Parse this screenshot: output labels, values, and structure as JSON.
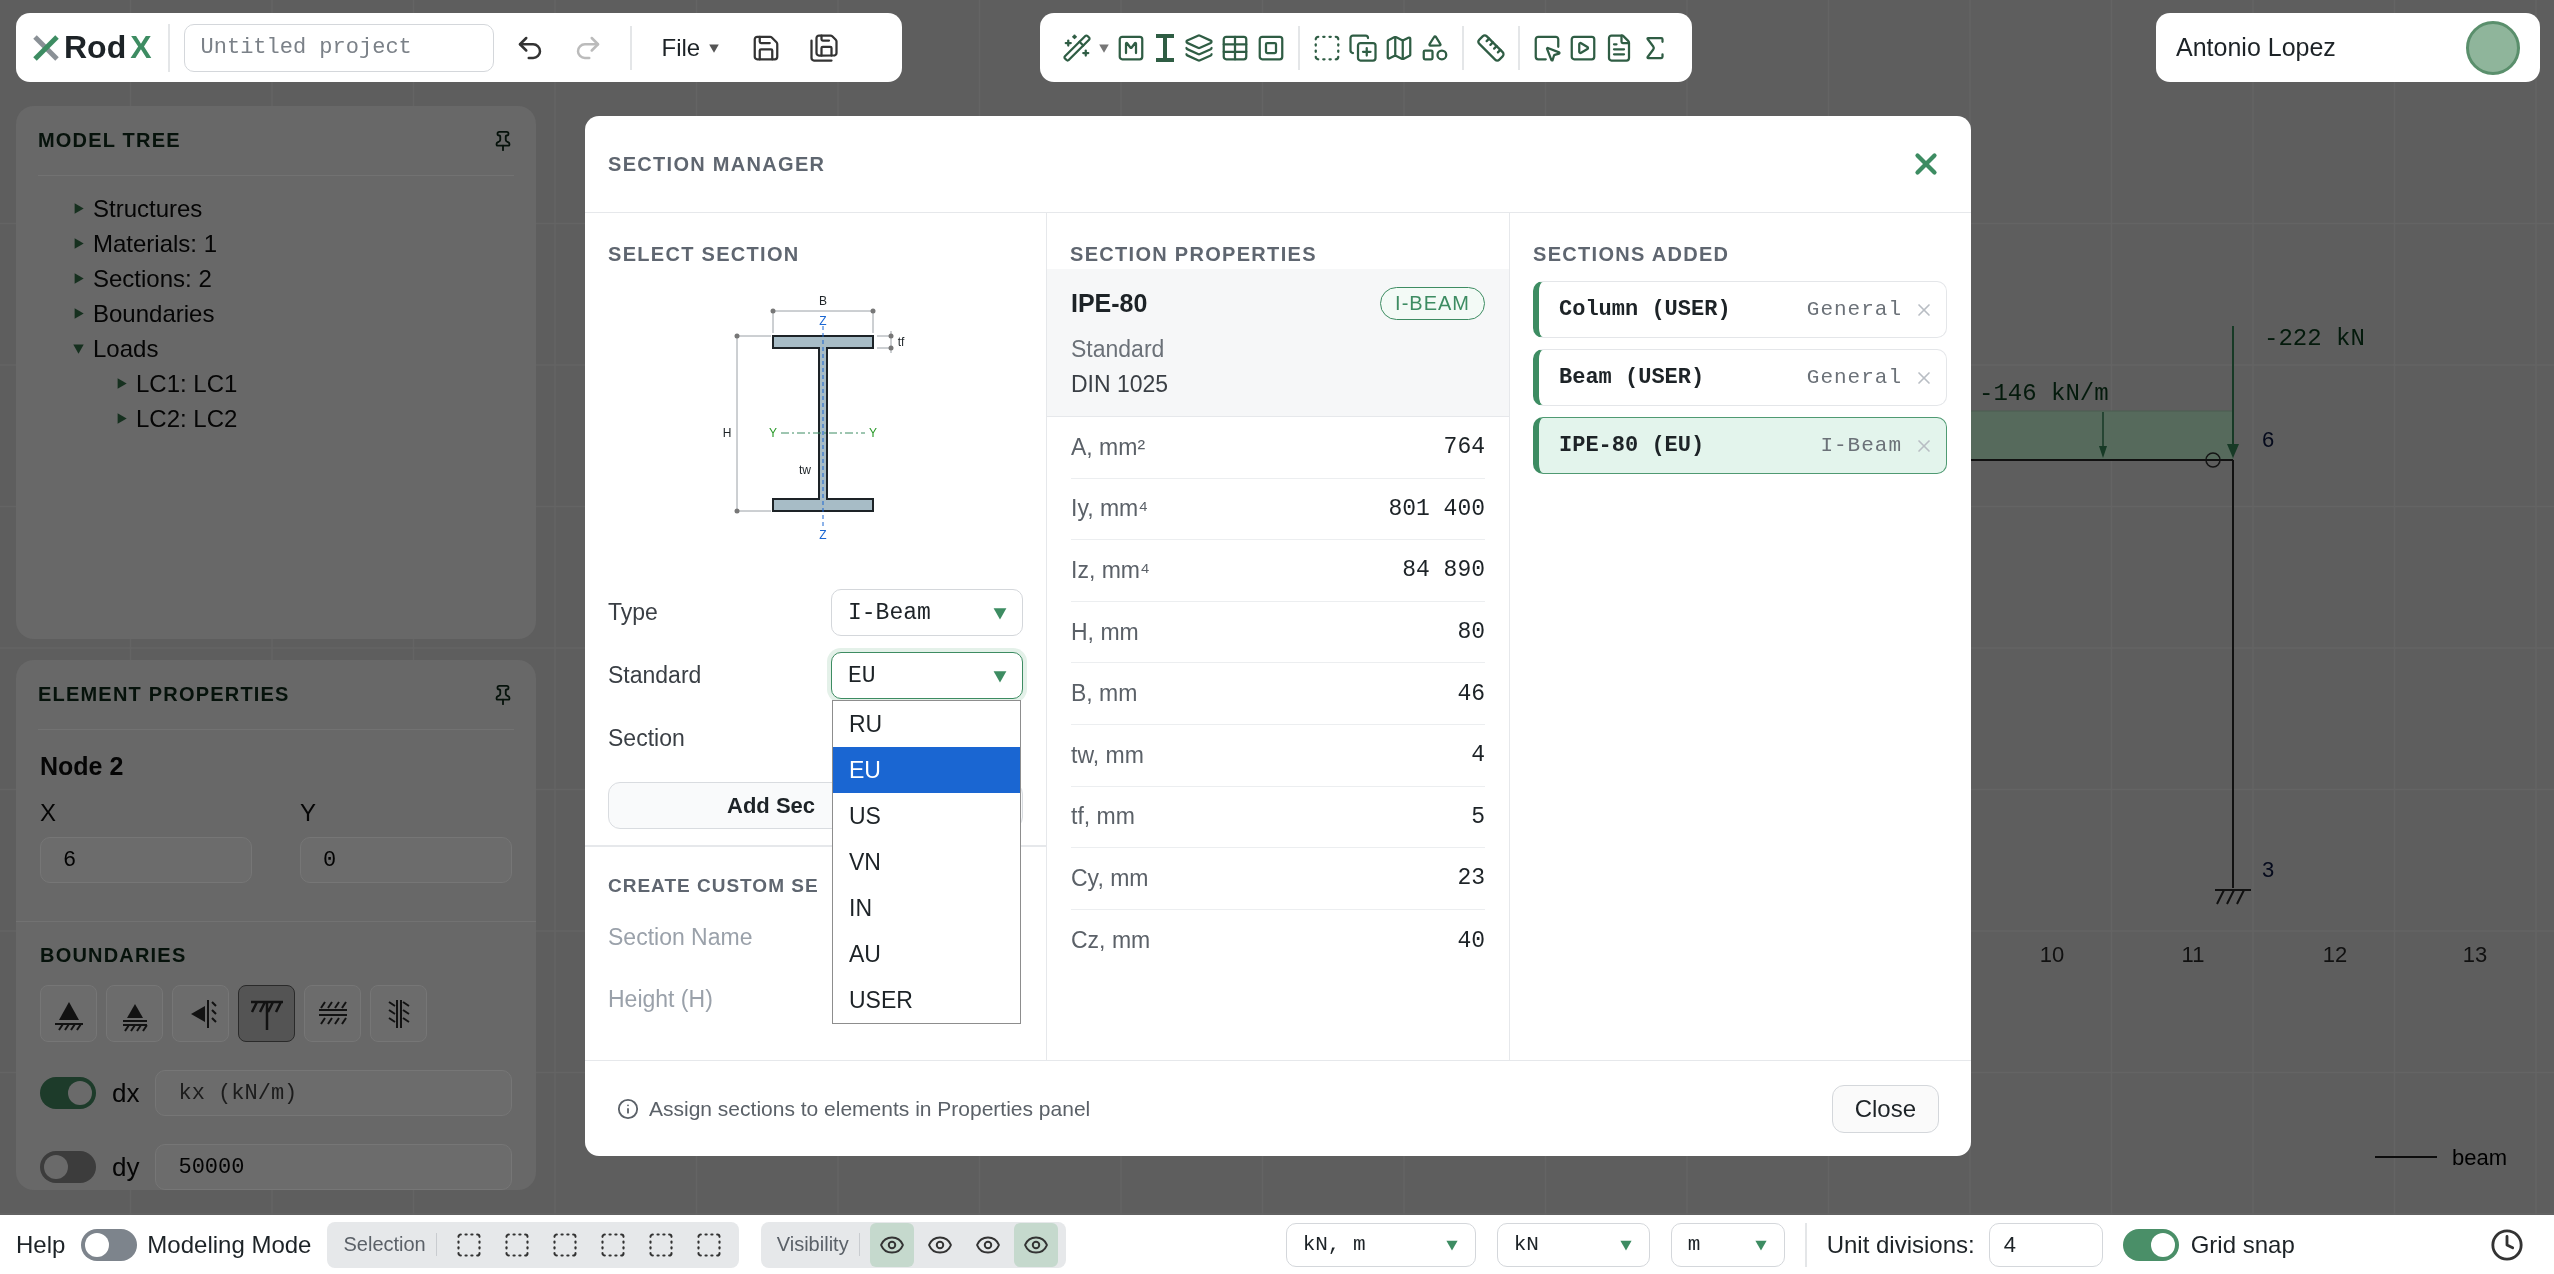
{
  "app_bar": {
    "logo_main": "Rod",
    "logo_accent": "X",
    "project_placeholder": "Untitled project",
    "file_menu": "File"
  },
  "user": {
    "name": "Antonio Lopez"
  },
  "model_tree": {
    "title": "MODEL TREE",
    "items": [
      {
        "label": "Structures",
        "expanded": false
      },
      {
        "label": "Materials: 1",
        "expanded": false
      },
      {
        "label": "Sections: 2",
        "expanded": false
      },
      {
        "label": "Boundaries",
        "expanded": false
      },
      {
        "label": "Loads",
        "expanded": true,
        "children": [
          {
            "label": "LC1: LC1",
            "expanded": false
          },
          {
            "label": "LC2: LC2",
            "expanded": false
          }
        ]
      }
    ]
  },
  "element_properties": {
    "title": "ELEMENT PROPERTIES",
    "node": "Node 2",
    "fields": [
      {
        "label": "X",
        "value": "6"
      },
      {
        "label": "Y",
        "value": "0"
      }
    ],
    "boundaries_title": "BOUNDARIES",
    "boundaries": [
      {
        "kind": "pin",
        "selected": false
      },
      {
        "kind": "roller",
        "selected": false
      },
      {
        "kind": "side-roller",
        "selected": false
      },
      {
        "kind": "fixed",
        "selected": true
      },
      {
        "kind": "guided",
        "selected": false
      },
      {
        "kind": "wall",
        "selected": false
      }
    ],
    "springs": [
      {
        "label": "dx",
        "on": true,
        "placeholder": "kx (kN/m)"
      },
      {
        "label": "dy",
        "on": false,
        "value": "50000"
      }
    ]
  },
  "canvas": {
    "point_load": "-222 kN",
    "distributed_load": "-146 kN/m",
    "nodes": [
      "6",
      "3"
    ],
    "axis_ticks": [
      "10",
      "11",
      "12",
      "13"
    ],
    "legend": "beam"
  },
  "section_manager": {
    "title": "SECTION MANAGER",
    "select_section": {
      "title": "SELECT SECTION",
      "diagram_labels": {
        "b": "B",
        "z_top": "Z",
        "tf": "tf",
        "h": "H",
        "y_left": "Y",
        "y_right": "Y",
        "tw": "tw",
        "z_bottom": "Z"
      },
      "type": {
        "label": "Type",
        "value": "I-Beam"
      },
      "standard": {
        "label": "Standard",
        "value": "EU",
        "expanded": true,
        "options": [
          {
            "label": "RU",
            "selected": false
          },
          {
            "label": "EU",
            "selected": true
          },
          {
            "label": "US",
            "selected": false
          },
          {
            "label": "VN",
            "selected": false
          },
          {
            "label": "IN",
            "selected": false
          },
          {
            "label": "AU",
            "selected": false
          },
          {
            "label": "USER",
            "selected": false
          }
        ]
      },
      "section_label": "Section",
      "add_button": "Add Sec"
    },
    "custom_section": {
      "title": "CREATE CUSTOM SE",
      "fields": [
        "Section Name",
        "Height (H)"
      ]
    },
    "section_properties": {
      "title": "SECTION PROPERTIES",
      "name": "IPE-80",
      "badge": "I-BEAM",
      "standard_label": "Standard",
      "standard_value": "DIN 1025",
      "rows": [
        {
          "label": "A, mm²",
          "value": "764"
        },
        {
          "label": "Iy, mm⁴",
          "value": "801 400"
        },
        {
          "label": "Iz, mm⁴",
          "value": "84 890"
        },
        {
          "label": "H, mm",
          "value": "80"
        },
        {
          "label": "B, mm",
          "value": "46"
        },
        {
          "label": "tw, mm",
          "value": "4"
        },
        {
          "label": "tf, mm",
          "value": "5"
        },
        {
          "label": "Cy, mm",
          "value": "23"
        },
        {
          "label": "Cz, mm",
          "value": "40"
        }
      ]
    },
    "sections_added": {
      "title": "SECTIONS ADDED",
      "items": [
        {
          "name": "Column (USER)",
          "type": "General",
          "selected": false
        },
        {
          "name": "Beam (USER)",
          "type": "General",
          "selected": false
        },
        {
          "name": "IPE-80 (EU)",
          "type": "I-Beam",
          "selected": true
        }
      ]
    },
    "footer_note": "Assign sections to elements in Properties panel",
    "close_button": "Close"
  },
  "status_bar": {
    "help": "Help",
    "modeling_mode": {
      "label": "Modeling Mode",
      "on": false
    },
    "selection_label": "Selection",
    "visibility_label": "Visibility",
    "visibility": [
      {
        "selected": true
      },
      {
        "selected": false
      },
      {
        "selected": false
      },
      {
        "selected": true
      }
    ],
    "units": [
      {
        "value": "kN, m"
      },
      {
        "value": "kN"
      },
      {
        "value": "m"
      }
    ],
    "unit_divisions": {
      "label": "Unit divisions:",
      "value": "4"
    },
    "grid_snap": {
      "label": "Grid snap",
      "on": true
    }
  }
}
